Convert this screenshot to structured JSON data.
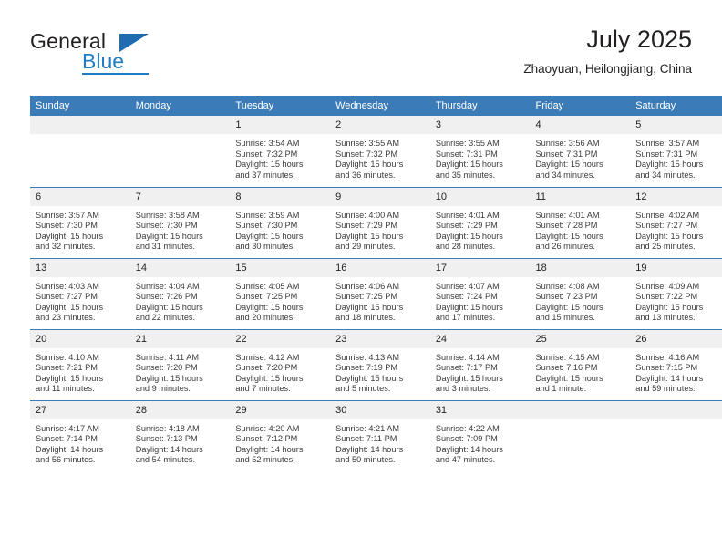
{
  "brand": {
    "name_part1": "General",
    "name_part2": "Blue",
    "triangle_color": "#1f6cb0",
    "blue_color": "#1f7dc4"
  },
  "header": {
    "month_title": "July 2025",
    "location": "Zhaoyuan, Heilongjiang, China"
  },
  "theme": {
    "header_bg": "#3b7cb8",
    "daynum_bg": "#f0f0f0",
    "text_color": "#231f20"
  },
  "weekday_headers": [
    "Sunday",
    "Monday",
    "Tuesday",
    "Wednesday",
    "Thursday",
    "Friday",
    "Saturday"
  ],
  "weeks": [
    [
      {
        "day": "",
        "lines": [
          "",
          "",
          "",
          ""
        ],
        "blank": true
      },
      {
        "day": "",
        "lines": [
          "",
          "",
          "",
          ""
        ],
        "blank": true
      },
      {
        "day": "1",
        "lines": [
          "Sunrise: 3:54 AM",
          "Sunset: 7:32 PM",
          "Daylight: 15 hours",
          "and 37 minutes."
        ]
      },
      {
        "day": "2",
        "lines": [
          "Sunrise: 3:55 AM",
          "Sunset: 7:32 PM",
          "Daylight: 15 hours",
          "and 36 minutes."
        ]
      },
      {
        "day": "3",
        "lines": [
          "Sunrise: 3:55 AM",
          "Sunset: 7:31 PM",
          "Daylight: 15 hours",
          "and 35 minutes."
        ]
      },
      {
        "day": "4",
        "lines": [
          "Sunrise: 3:56 AM",
          "Sunset: 7:31 PM",
          "Daylight: 15 hours",
          "and 34 minutes."
        ]
      },
      {
        "day": "5",
        "lines": [
          "Sunrise: 3:57 AM",
          "Sunset: 7:31 PM",
          "Daylight: 15 hours",
          "and 34 minutes."
        ]
      }
    ],
    [
      {
        "day": "6",
        "lines": [
          "Sunrise: 3:57 AM",
          "Sunset: 7:30 PM",
          "Daylight: 15 hours",
          "and 32 minutes."
        ]
      },
      {
        "day": "7",
        "lines": [
          "Sunrise: 3:58 AM",
          "Sunset: 7:30 PM",
          "Daylight: 15 hours",
          "and 31 minutes."
        ]
      },
      {
        "day": "8",
        "lines": [
          "Sunrise: 3:59 AM",
          "Sunset: 7:30 PM",
          "Daylight: 15 hours",
          "and 30 minutes."
        ]
      },
      {
        "day": "9",
        "lines": [
          "Sunrise: 4:00 AM",
          "Sunset: 7:29 PM",
          "Daylight: 15 hours",
          "and 29 minutes."
        ]
      },
      {
        "day": "10",
        "lines": [
          "Sunrise: 4:01 AM",
          "Sunset: 7:29 PM",
          "Daylight: 15 hours",
          "and 28 minutes."
        ]
      },
      {
        "day": "11",
        "lines": [
          "Sunrise: 4:01 AM",
          "Sunset: 7:28 PM",
          "Daylight: 15 hours",
          "and 26 minutes."
        ]
      },
      {
        "day": "12",
        "lines": [
          "Sunrise: 4:02 AM",
          "Sunset: 7:27 PM",
          "Daylight: 15 hours",
          "and 25 minutes."
        ]
      }
    ],
    [
      {
        "day": "13",
        "lines": [
          "Sunrise: 4:03 AM",
          "Sunset: 7:27 PM",
          "Daylight: 15 hours",
          "and 23 minutes."
        ]
      },
      {
        "day": "14",
        "lines": [
          "Sunrise: 4:04 AM",
          "Sunset: 7:26 PM",
          "Daylight: 15 hours",
          "and 22 minutes."
        ]
      },
      {
        "day": "15",
        "lines": [
          "Sunrise: 4:05 AM",
          "Sunset: 7:25 PM",
          "Daylight: 15 hours",
          "and 20 minutes."
        ]
      },
      {
        "day": "16",
        "lines": [
          "Sunrise: 4:06 AM",
          "Sunset: 7:25 PM",
          "Daylight: 15 hours",
          "and 18 minutes."
        ]
      },
      {
        "day": "17",
        "lines": [
          "Sunrise: 4:07 AM",
          "Sunset: 7:24 PM",
          "Daylight: 15 hours",
          "and 17 minutes."
        ]
      },
      {
        "day": "18",
        "lines": [
          "Sunrise: 4:08 AM",
          "Sunset: 7:23 PM",
          "Daylight: 15 hours",
          "and 15 minutes."
        ]
      },
      {
        "day": "19",
        "lines": [
          "Sunrise: 4:09 AM",
          "Sunset: 7:22 PM",
          "Daylight: 15 hours",
          "and 13 minutes."
        ]
      }
    ],
    [
      {
        "day": "20",
        "lines": [
          "Sunrise: 4:10 AM",
          "Sunset: 7:21 PM",
          "Daylight: 15 hours",
          "and 11 minutes."
        ]
      },
      {
        "day": "21",
        "lines": [
          "Sunrise: 4:11 AM",
          "Sunset: 7:20 PM",
          "Daylight: 15 hours",
          "and 9 minutes."
        ]
      },
      {
        "day": "22",
        "lines": [
          "Sunrise: 4:12 AM",
          "Sunset: 7:20 PM",
          "Daylight: 15 hours",
          "and 7 minutes."
        ]
      },
      {
        "day": "23",
        "lines": [
          "Sunrise: 4:13 AM",
          "Sunset: 7:19 PM",
          "Daylight: 15 hours",
          "and 5 minutes."
        ]
      },
      {
        "day": "24",
        "lines": [
          "Sunrise: 4:14 AM",
          "Sunset: 7:17 PM",
          "Daylight: 15 hours",
          "and 3 minutes."
        ]
      },
      {
        "day": "25",
        "lines": [
          "Sunrise: 4:15 AM",
          "Sunset: 7:16 PM",
          "Daylight: 15 hours",
          "and 1 minute."
        ]
      },
      {
        "day": "26",
        "lines": [
          "Sunrise: 4:16 AM",
          "Sunset: 7:15 PM",
          "Daylight: 14 hours",
          "and 59 minutes."
        ]
      }
    ],
    [
      {
        "day": "27",
        "lines": [
          "Sunrise: 4:17 AM",
          "Sunset: 7:14 PM",
          "Daylight: 14 hours",
          "and 56 minutes."
        ]
      },
      {
        "day": "28",
        "lines": [
          "Sunrise: 4:18 AM",
          "Sunset: 7:13 PM",
          "Daylight: 14 hours",
          "and 54 minutes."
        ]
      },
      {
        "day": "29",
        "lines": [
          "Sunrise: 4:20 AM",
          "Sunset: 7:12 PM",
          "Daylight: 14 hours",
          "and 52 minutes."
        ]
      },
      {
        "day": "30",
        "lines": [
          "Sunrise: 4:21 AM",
          "Sunset: 7:11 PM",
          "Daylight: 14 hours",
          "and 50 minutes."
        ]
      },
      {
        "day": "31",
        "lines": [
          "Sunrise: 4:22 AM",
          "Sunset: 7:09 PM",
          "Daylight: 14 hours",
          "and 47 minutes."
        ]
      },
      {
        "day": "",
        "lines": [
          "",
          "",
          "",
          ""
        ],
        "blank": true
      },
      {
        "day": "",
        "lines": [
          "",
          "",
          "",
          ""
        ],
        "blank": true
      }
    ]
  ]
}
